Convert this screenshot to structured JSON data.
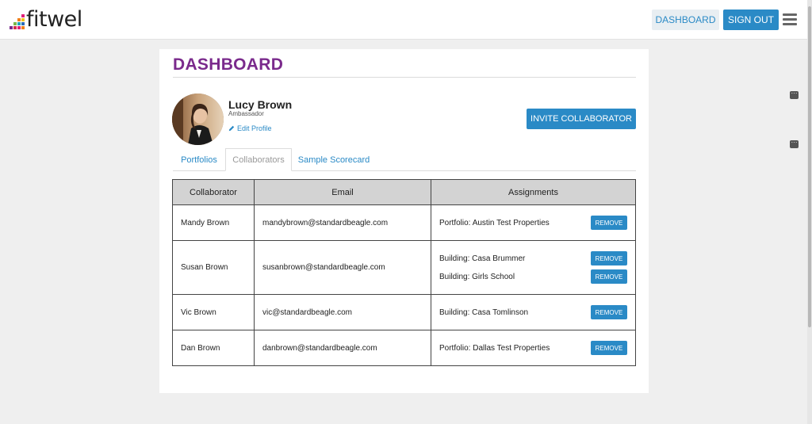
{
  "brand": {
    "name": "fitwel",
    "bar_colors": [
      "#e0207a",
      "#f07f1a",
      "#f2c318",
      "#7ab648",
      "#1ea7b8",
      "#2a6bb8",
      "#7a2a8c",
      "#d12e4c"
    ]
  },
  "nav": {
    "dashboard_label": "DASHBOARD",
    "signout_label": "SIGN OUT"
  },
  "page": {
    "title": "DASHBOARD"
  },
  "profile": {
    "name": "Lucy Brown",
    "role": "Ambassador",
    "edit_label": "Edit Profile"
  },
  "actions": {
    "invite_label": "INVITE COLLABORATOR"
  },
  "tabs": [
    {
      "label": "Portfolios",
      "active": false
    },
    {
      "label": "Collaborators",
      "active": true
    },
    {
      "label": "Sample Scorecard",
      "active": false
    }
  ],
  "table": {
    "headers": [
      "Collaborator",
      "Email",
      "Assignments"
    ],
    "remove_label": "REMOVE",
    "rows": [
      {
        "name": "Mandy Brown",
        "email": "mandybrown@standardbeagle.com",
        "assignments": [
          "Portfolio: Austin Test Properties"
        ]
      },
      {
        "name": "Susan Brown",
        "email": "susanbrown@standardbeagle.com",
        "assignments": [
          "Building: Casa Brummer",
          "Building: Girls School"
        ]
      },
      {
        "name": "Vic Brown",
        "email": "vic@standardbeagle.com",
        "assignments": [
          "Building: Casa Tomlinson"
        ]
      },
      {
        "name": "Dan Brown",
        "email": "danbrown@standardbeagle.com",
        "assignments": [
          "Portfolio: Dallas Test Properties"
        ]
      }
    ]
  },
  "colors": {
    "accent": "#2a8ac6",
    "title": "#7a2a8c"
  }
}
